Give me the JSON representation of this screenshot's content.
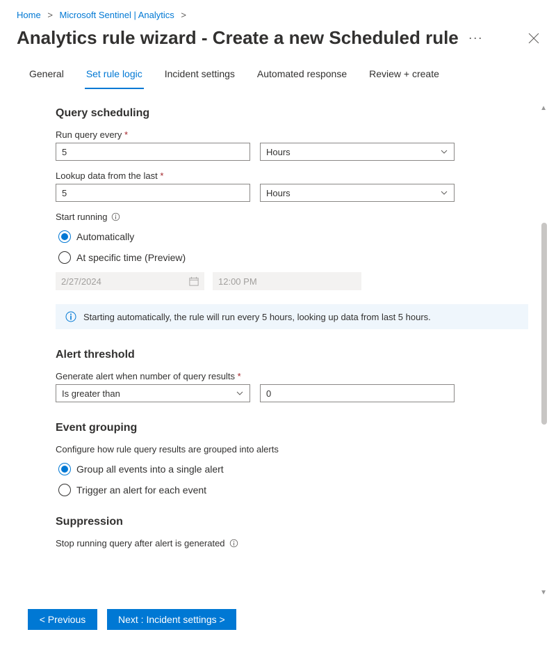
{
  "breadcrumb": {
    "items": [
      "Home",
      "Microsoft Sentinel | Analytics"
    ],
    "sep": ">"
  },
  "header": {
    "title": "Analytics rule wizard - Create a new Scheduled rule",
    "more": "···"
  },
  "tabs": [
    {
      "label": "General",
      "active": false
    },
    {
      "label": "Set rule logic",
      "active": true
    },
    {
      "label": "Incident settings",
      "active": false
    },
    {
      "label": "Automated response",
      "active": false
    },
    {
      "label": "Review + create",
      "active": false
    }
  ],
  "scheduling": {
    "title": "Query scheduling",
    "run_label": "Run query every ",
    "run_value": "5",
    "run_unit": "Hours",
    "lookup_label": "Lookup data from the last ",
    "lookup_value": "5",
    "lookup_unit": "Hours",
    "start_label": "Start running",
    "auto_label": "Automatically",
    "specific_label": "At specific time (Preview)",
    "date_value": "2/27/2024",
    "time_value": "12:00 PM",
    "info": "Starting automatically, the rule will run every 5 hours, looking up data from last 5 hours."
  },
  "threshold": {
    "title": "Alert threshold",
    "label": "Generate alert when number of query results ",
    "op": "Is greater than",
    "value": "0"
  },
  "grouping": {
    "title": "Event grouping",
    "desc": "Configure how rule query results are grouped into alerts",
    "opt1": "Group all events into a single alert",
    "opt2": "Trigger an alert for each event"
  },
  "suppression": {
    "title": "Suppression",
    "label": "Stop running query after alert is generated",
    "state": "Off"
  },
  "footer": {
    "prev": "< Previous",
    "next": "Next : Incident settings >"
  },
  "req_marker": "*"
}
